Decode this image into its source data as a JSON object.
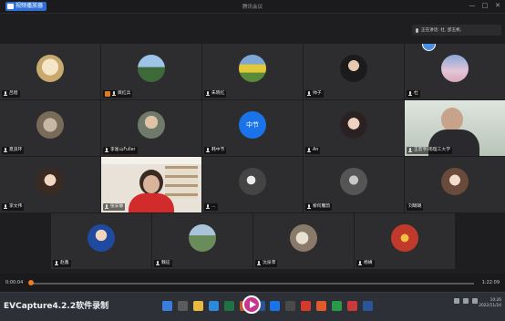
{
  "window": {
    "app_tag": "视频播放器",
    "title": "腾讯会议",
    "controls": [
      "—",
      "□",
      "✕"
    ]
  },
  "speaking_indicator": "正在讲话: 杜, 邵玉帆;",
  "participants_row1": [
    {
      "name": "吕程"
    },
    {
      "name": "龚红兵",
      "host": true
    },
    {
      "name": "朱晓红"
    },
    {
      "name": "帅子"
    },
    {
      "name": "杜"
    }
  ],
  "participants_row2": [
    {
      "name": "夏良环"
    },
    {
      "name": "李富山Fuller"
    },
    {
      "name": "韩中节",
      "avatar_text": "中节"
    },
    {
      "name": "An"
    },
    {
      "name": "王宏宇/南理工大学"
    }
  ],
  "participants_row3": [
    {
      "name": "李文伟"
    },
    {
      "name": "张安静"
    },
    {
      "name": "..."
    },
    {
      "name": "黎何馨韵"
    },
    {
      "name": "刘璐璐"
    }
  ],
  "participants_row4": [
    {
      "name": "赵鑫"
    },
    {
      "name": "魏征"
    },
    {
      "name": "沈泉萍"
    },
    {
      "name": "杨婧"
    }
  ],
  "player": {
    "current_time": "0:00:04",
    "total_time": "1:22:09",
    "progress": 0.005
  },
  "watermark": "EVCapture4.2.2软件录制",
  "clock": {
    "time": "10:26",
    "date": "2022/11/24"
  },
  "colors": {
    "avatar_blue": "#1a73e8",
    "host_orange": "#e07b1b",
    "record_pink": "#c5368c"
  }
}
